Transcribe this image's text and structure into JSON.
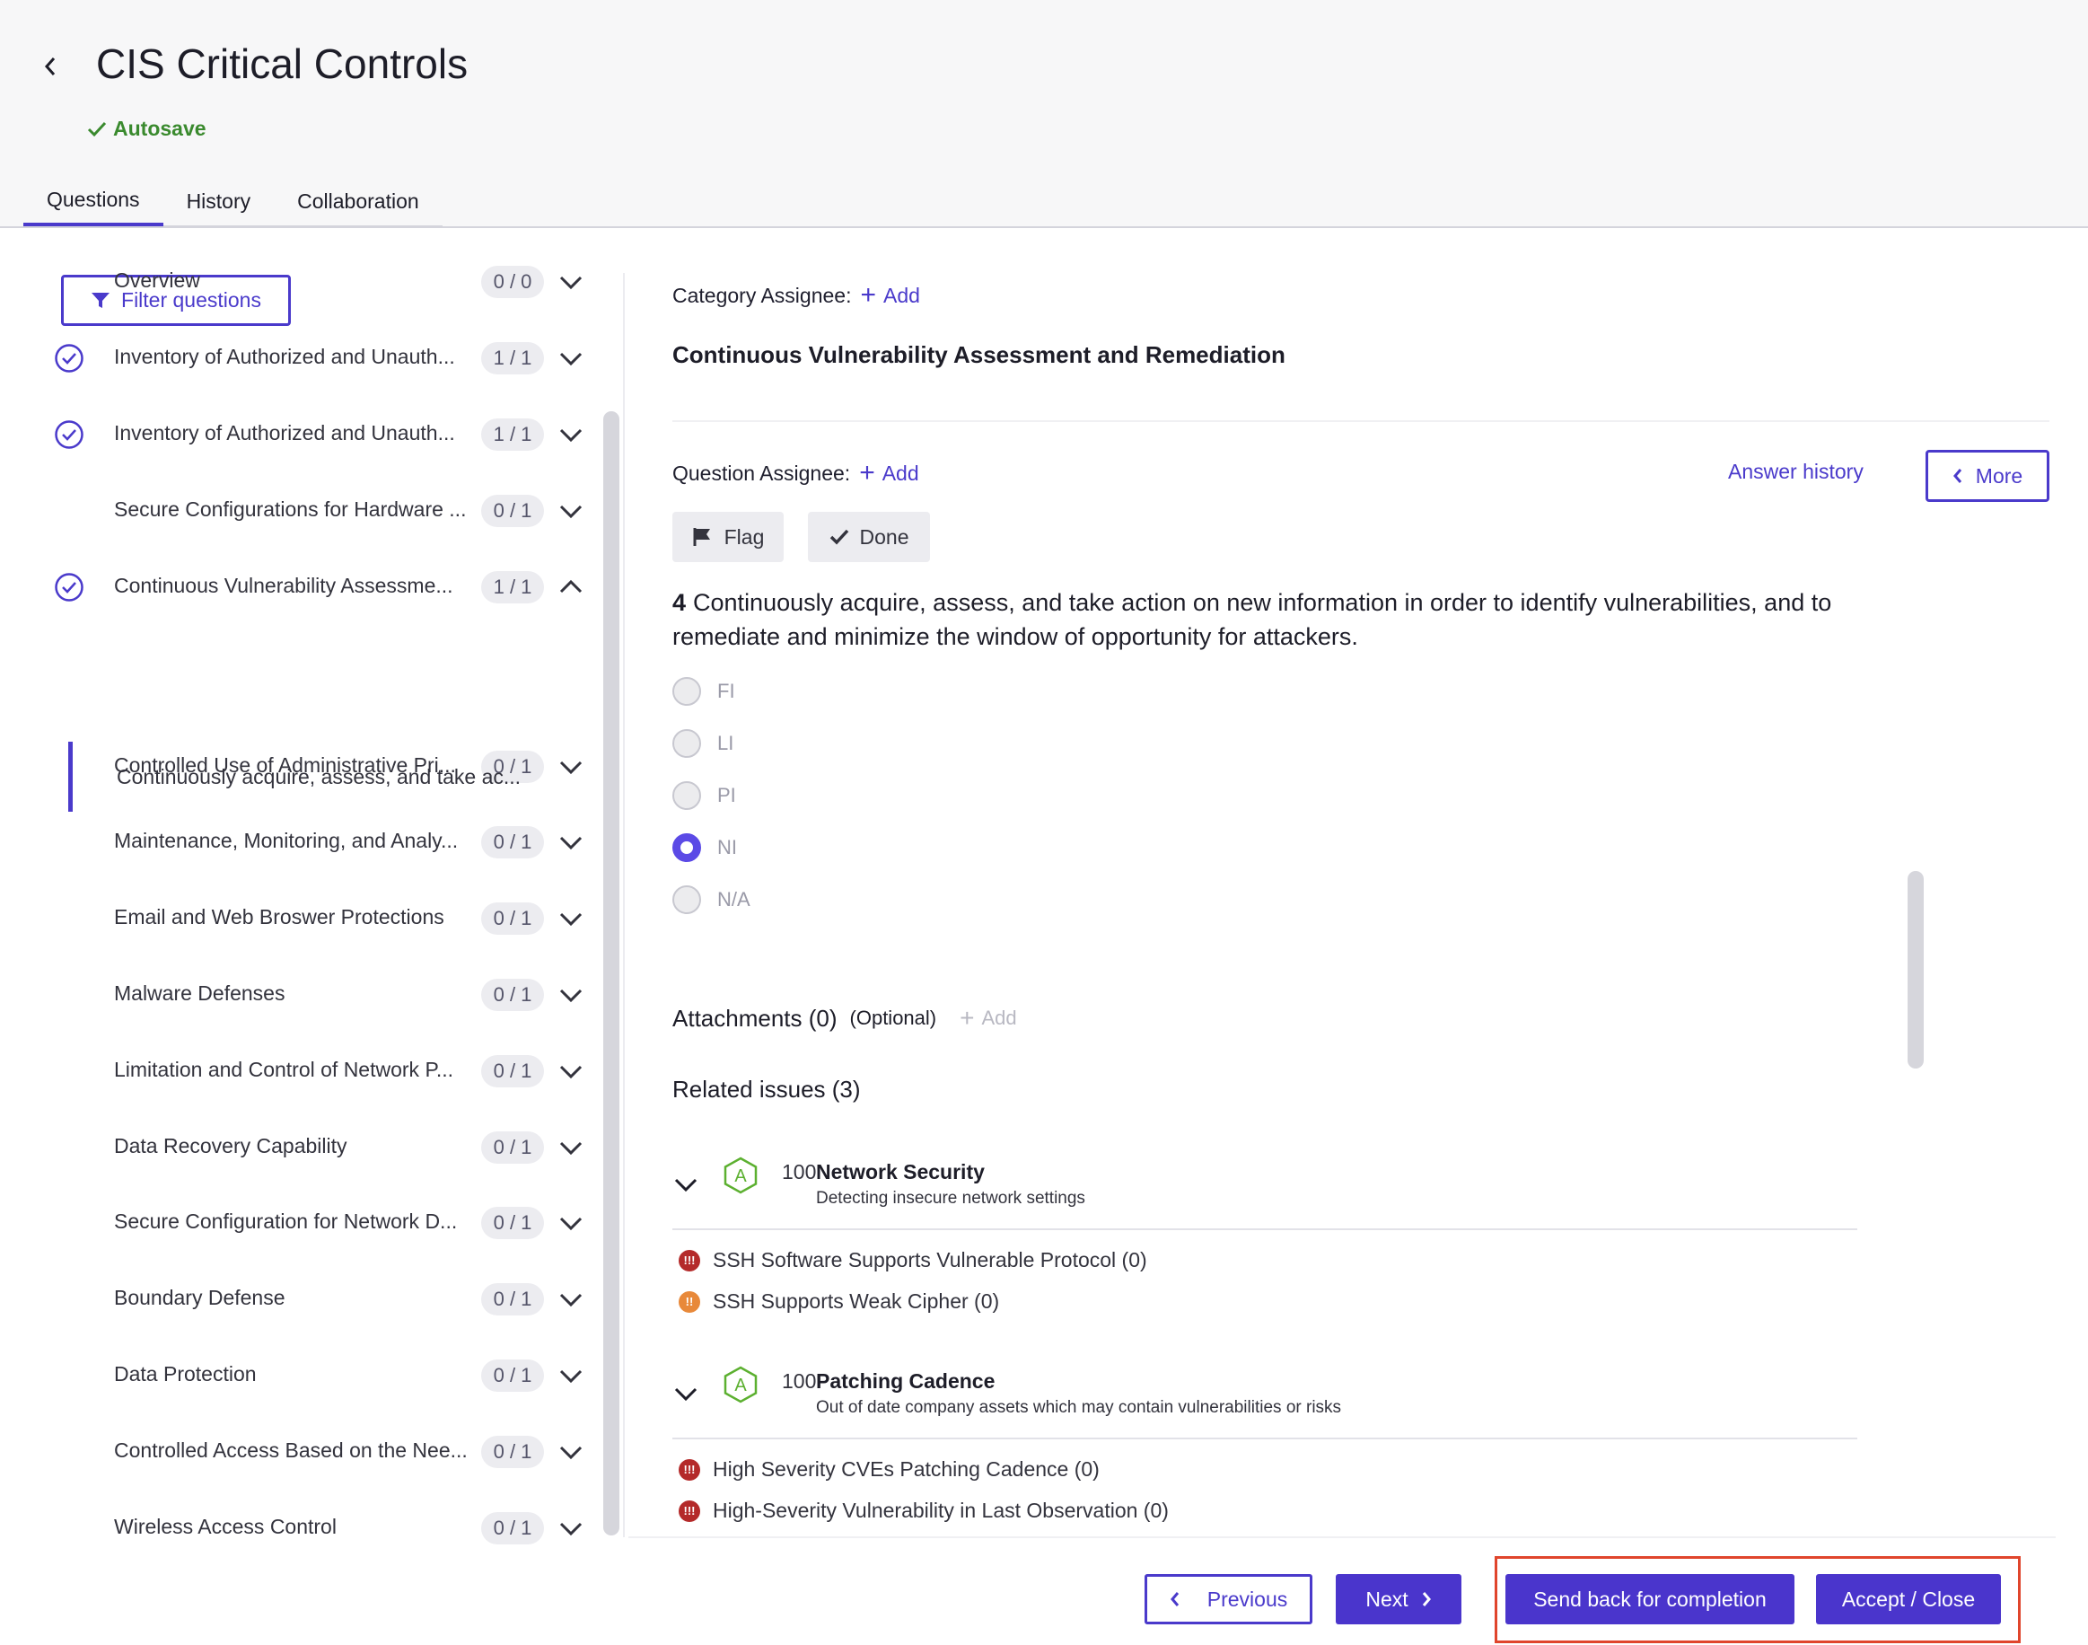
{
  "header": {
    "title": "CIS Critical Controls",
    "autosave": "Autosave",
    "tabs": [
      {
        "label": "Questions",
        "active": true
      },
      {
        "label": "History",
        "active": false
      },
      {
        "label": "Collaboration",
        "active": false
      }
    ]
  },
  "sidebar": {
    "filter_label": "Filter questions",
    "categories": [
      {
        "label": "Overview",
        "count": "0 / 0",
        "completed": false
      },
      {
        "label": "Inventory of Authorized and Unauth...",
        "count": "1 / 1",
        "completed": true
      },
      {
        "label": "Inventory of Authorized and Unauth...",
        "count": "1 / 1",
        "completed": true
      },
      {
        "label": "Secure Configurations for Hardware ...",
        "count": "0 / 1",
        "completed": false
      },
      {
        "label": "Continuous Vulnerability Assessme...",
        "count": "1 / 1",
        "completed": true,
        "expanded": true
      },
      {
        "label": "Controlled Use of Administrative Pri...",
        "count": "0 / 1",
        "completed": false
      },
      {
        "label": "Maintenance, Monitoring, and Analy...",
        "count": "0 / 1",
        "completed": false
      },
      {
        "label": "Email and Web Broswer Protections",
        "count": "0 / 1",
        "completed": false
      },
      {
        "label": "Malware Defenses",
        "count": "0 / 1",
        "completed": false
      },
      {
        "label": "Limitation and Control of Network P...",
        "count": "0 / 1",
        "completed": false
      },
      {
        "label": "Data Recovery Capability",
        "count": "0 / 1",
        "completed": false
      },
      {
        "label": "Secure Configuration for Network D...",
        "count": "0 / 1",
        "completed": false
      },
      {
        "label": "Boundary Defense",
        "count": "0 / 1",
        "completed": false
      },
      {
        "label": "Data Protection",
        "count": "0 / 1",
        "completed": false
      },
      {
        "label": "Controlled Access Based on the Nee...",
        "count": "0 / 1",
        "completed": false
      },
      {
        "label": "Wireless Access Control",
        "count": "0 / 1",
        "completed": false
      }
    ],
    "selected_question": "Continuously acquire, assess, and take ac..."
  },
  "main": {
    "category_assignee_label": "Category Assignee:",
    "add_label": "Add",
    "category_title": "Continuous Vulnerability Assessment and Remediation",
    "question_assignee_label": "Question Assignee:",
    "answer_history": "Answer history",
    "more_label": "More",
    "flag_label": "Flag",
    "done_label": "Done",
    "question_number": "4",
    "question_text": "Continuously acquire, assess, and take action on new information in order to identify vulnerabilities, and to remediate and minimize the window of opportunity for attackers.",
    "options": [
      {
        "label": "FI",
        "selected": false
      },
      {
        "label": "LI",
        "selected": false
      },
      {
        "label": "PI",
        "selected": false
      },
      {
        "label": "NI",
        "selected": true
      },
      {
        "label": "N/A",
        "selected": false
      }
    ],
    "attachments_label": "Attachments (0)",
    "optional_label": "(Optional)",
    "attachments_add": "Add",
    "related_issues_label": "Related issues (3)",
    "issue_groups": [
      {
        "grade": "A",
        "score": "100",
        "name": "Network Security",
        "description": "Detecting insecure network settings",
        "issues": [
          {
            "label": "SSH Software Supports Vulnerable Protocol (0)",
            "severity": "high"
          },
          {
            "label": "SSH Supports Weak Cipher (0)",
            "severity": "medium"
          }
        ]
      },
      {
        "grade": "A",
        "score": "100",
        "name": "Patching Cadence",
        "description": "Out of date company assets which may contain vulnerabilities or risks",
        "issues": [
          {
            "label": "High Severity CVEs Patching Cadence (0)",
            "severity": "high"
          },
          {
            "label": "High-Severity Vulnerability in Last Observation (0)",
            "severity": "high"
          }
        ]
      }
    ]
  },
  "footer": {
    "previous": "Previous",
    "next": "Next",
    "send_back": "Send back for completion",
    "accept_close": "Accept / Close"
  },
  "colors": {
    "accent": "#4a3acb",
    "autosave_green": "#3a8a2e",
    "grade_green": "#5cb030",
    "severity_high": "#b42a2a",
    "severity_medium": "#e8893a",
    "highlight_red": "#e0452c"
  }
}
